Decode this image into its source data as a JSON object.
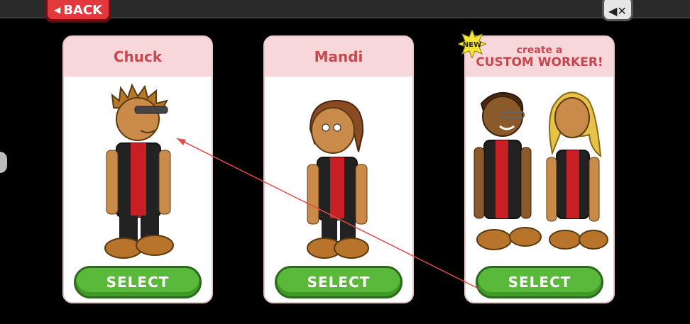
{
  "topbar": {
    "back_label": "BACK",
    "mute_icon": "speaker-mute-icon"
  },
  "cards": [
    {
      "name": "Chuck",
      "select_label": "SELECT"
    },
    {
      "name": "Mandi",
      "select_label": "SELECT"
    },
    {
      "line1": "create a",
      "line2": "CUSTOM WORKER!",
      "badge": "NEW",
      "select_label": "SELECT"
    }
  ],
  "colors": {
    "header_bg": "#f7d7d9",
    "header_text": "#c8474f",
    "select_green": "#5ab83a",
    "back_red": "#e3383c"
  }
}
